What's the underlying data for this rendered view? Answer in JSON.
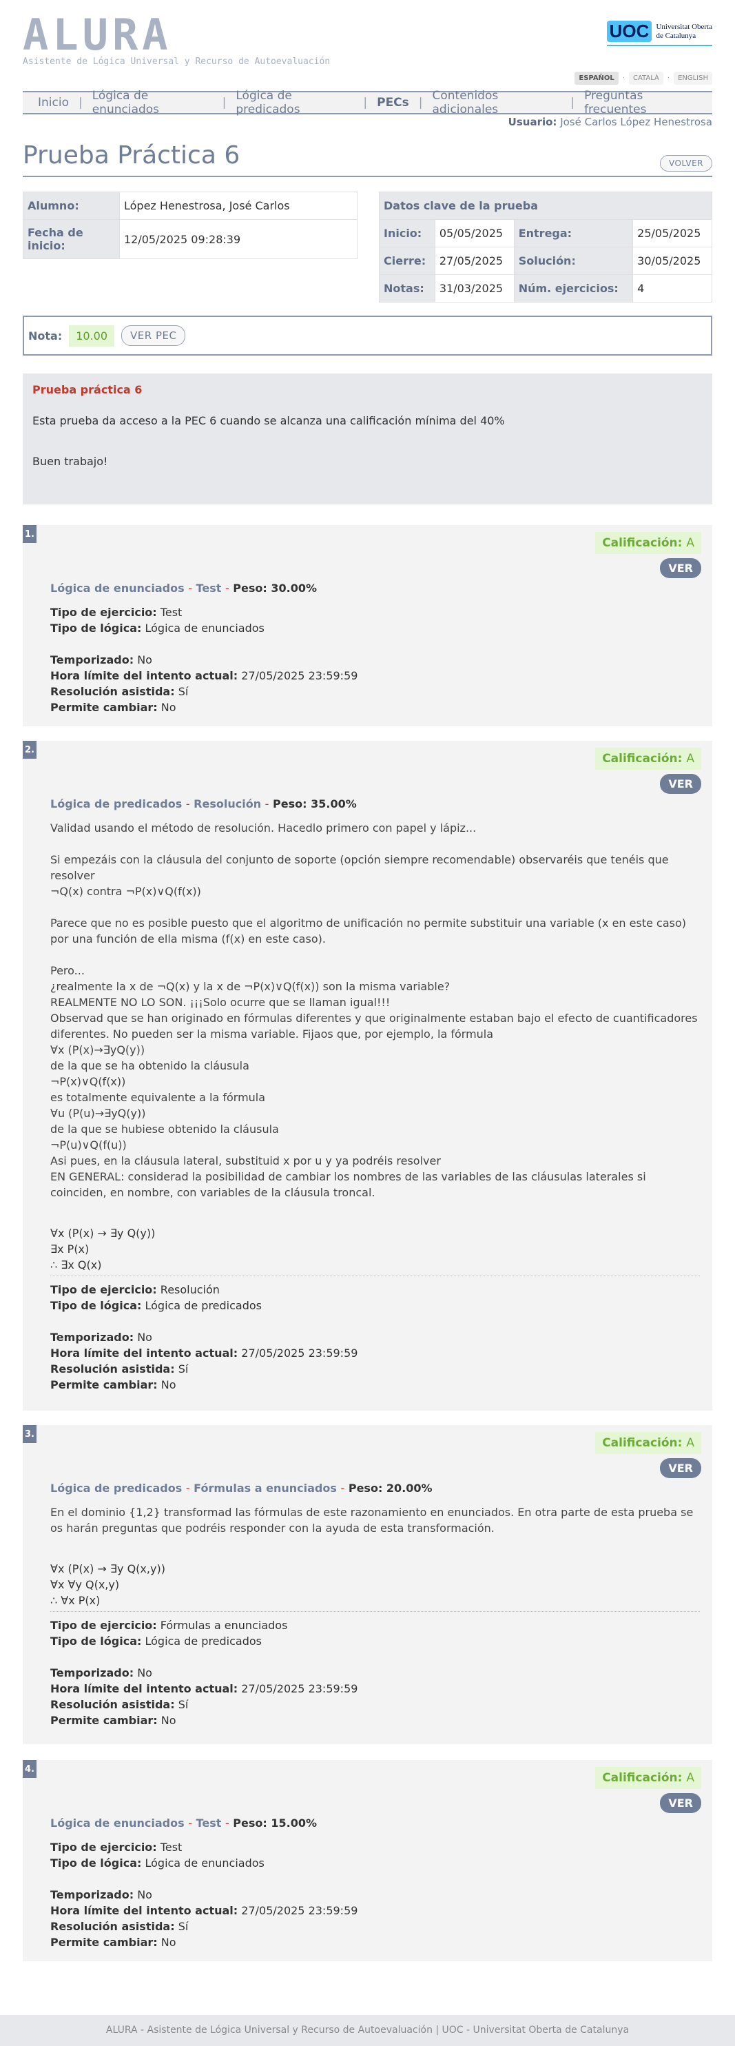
{
  "app": {
    "logo_text": "ALURA",
    "logo_subtitle": "Asistente de Lógica Universal y Recurso de Autoevaluación",
    "uoc_mark": "UOC",
    "uoc_name_1": "Universitat Oberta",
    "uoc_name_2": "de Catalunya"
  },
  "langs": [
    "ESPAÑOL",
    "CATALÀ",
    "ENGLISH"
  ],
  "nav": [
    "Inicio",
    "Lógica de enunciados",
    "Lógica de predicados",
    "PECs",
    "Contenidos adicionales",
    "Preguntas frecuentes"
  ],
  "user": {
    "label": "Usuario:",
    "name": "José Carlos López Henestrosa"
  },
  "page": {
    "title": "Prueba Práctica 6",
    "back_label": "VOLVER"
  },
  "student": {
    "alumno_label": "Alumno:",
    "alumno": "López Henestrosa, José Carlos",
    "fecha_label": "Fecha de inicio:",
    "fecha": "12/05/2025 09:28:39"
  },
  "keys": {
    "header": "Datos clave de la prueba",
    "inicio_label": "Inicio:",
    "inicio": "05/05/2025",
    "entrega_label": "Entrega:",
    "entrega": "25/05/2025",
    "cierre_label": "Cierre:",
    "cierre": "27/05/2025",
    "solucion_label": "Solución:",
    "solucion": "30/05/2025",
    "notas_label": "Notas:",
    "notas": "31/03/2025",
    "num_label": "Núm. ejercicios:",
    "num": "4"
  },
  "grade": {
    "label": "Nota:",
    "value": "10.00",
    "pec_label": "VER PEC"
  },
  "intro": {
    "title": "Prueba práctica 6",
    "text": "Esta prueba da acceso a la PEC 6 cuando se alcanza una calificación mínima del 40%",
    "closing": "Buen trabajo!"
  },
  "labels": {
    "calificacion": "Calificación:",
    "ver": "VER",
    "peso": "Peso:",
    "tipo_ejercicio": "Tipo de ejercicio:",
    "tipo_logica": "Tipo de lógica:",
    "temporizado": "Temporizado:",
    "hora_limite": "Hora límite del intento actual:",
    "resolucion": "Resolución asistida:",
    "permite": "Permite cambiar:"
  },
  "exercises": [
    {
      "num": "1.",
      "grade": "A",
      "logic": "Lógica de enunciados",
      "type": "Test",
      "weight": "30.00%",
      "tipo_ejercicio": "Test",
      "tipo_logica": "Lógica de enunciados",
      "temporizado": "No",
      "hora_limite": "27/05/2025 23:59:59",
      "resolucion": "Sí",
      "permite": "No"
    },
    {
      "num": "2.",
      "grade": "A",
      "logic": "Lógica de predicados",
      "type": "Resolución",
      "weight": "35.00%",
      "desc": [
        "Validad usando el método de resolución. Hacedlo primero con papel y lápiz...",
        "",
        "Si empezáis con la cláusula del conjunto de soporte (opción siempre recomendable) observaréis que tenéis que resolver",
        "¬Q(x)   contra   ¬P(x)∨Q(f(x))",
        "",
        "Parece que no es posible puesto que el algoritmo de unificación no permite substituir una variable (x en este caso) por una función de ella misma (f(x) en este caso).",
        "",
        "Pero...",
        "¿realmente la x de ¬Q(x) y la x de ¬P(x)∨Q(f(x)) son la misma variable?",
        "REALMENTE NO LO SON. ¡¡¡Solo ocurre que se llaman igual!!!",
        "Observad que se han originado en fórmulas diferentes y que originalmente estaban bajo el efecto de cuantificadores diferentes. No pueden ser la misma variable. Fijaos que, por ejemplo, la fórmula",
        "∀x (P(x)→∃yQ(y))",
        "de la que se ha obtenido la cláusula",
        "¬P(x)∨Q(f(x))",
        "es totalmente equivalente a la fórmula",
        "∀u (P(u)→∃yQ(y))",
        "de la que se hubiese obtenido la cláusula",
        "¬P(u)∨Q(f(u))",
        "Asi pues, en la cláusula lateral, substituid x por u y ya podréis resolver",
        "EN  GENERAL: considerad la posibilidad de cambiar los nombres de las variables de las cláusulas laterales si coinciden, en nombre, con variables de la cláusula troncal."
      ],
      "formulas": [
        "∀x (P(x) → ∃y Q(y))",
        "∃x P(x)",
        "∴ ∃x Q(x)"
      ],
      "tipo_ejercicio": "Resolución",
      "tipo_logica": "Lógica de predicados",
      "temporizado": "No",
      "hora_limite": "27/05/2025 23:59:59",
      "resolucion": "Sí",
      "permite": "No"
    },
    {
      "num": "3.",
      "grade": "A",
      "logic": "Lógica de predicados",
      "type": "Fórmulas a enunciados",
      "weight": "20.00%",
      "desc": [
        "En el dominio {1,2} transformad las fórmulas de este razonamiento en enunciados. En otra parte de esta prueba se os harán preguntas que podréis responder con la ayuda de esta transformación."
      ],
      "formulas": [
        "∀x (P(x) → ∃y Q(x,y))",
        "∀x ∀y Q(x,y)",
        "∴ ∀x P(x)"
      ],
      "tipo_ejercicio": "Fórmulas a enunciados",
      "tipo_logica": "Lógica de predicados",
      "temporizado": "No",
      "hora_limite": "27/05/2025 23:59:59",
      "resolucion": "Sí",
      "permite": "No"
    },
    {
      "num": "4.",
      "grade": "A",
      "logic": "Lógica de enunciados",
      "type": "Test",
      "weight": "15.00%",
      "tipo_ejercicio": "Test",
      "tipo_logica": "Lógica de enunciados",
      "temporizado": "No",
      "hora_limite": "27/05/2025 23:59:59",
      "resolucion": "Sí",
      "permite": "No"
    }
  ],
  "footer": "ALURA - Asistente de Lógica Universal y Recurso de Autoevaluación | UOC - Universitat Oberta de Catalunya",
  "colors": {
    "accent": "#6f7d97",
    "grade_bg": "#e4f6d4",
    "grade_fg": "#6cac36",
    "intro_title": "#c0392b"
  }
}
